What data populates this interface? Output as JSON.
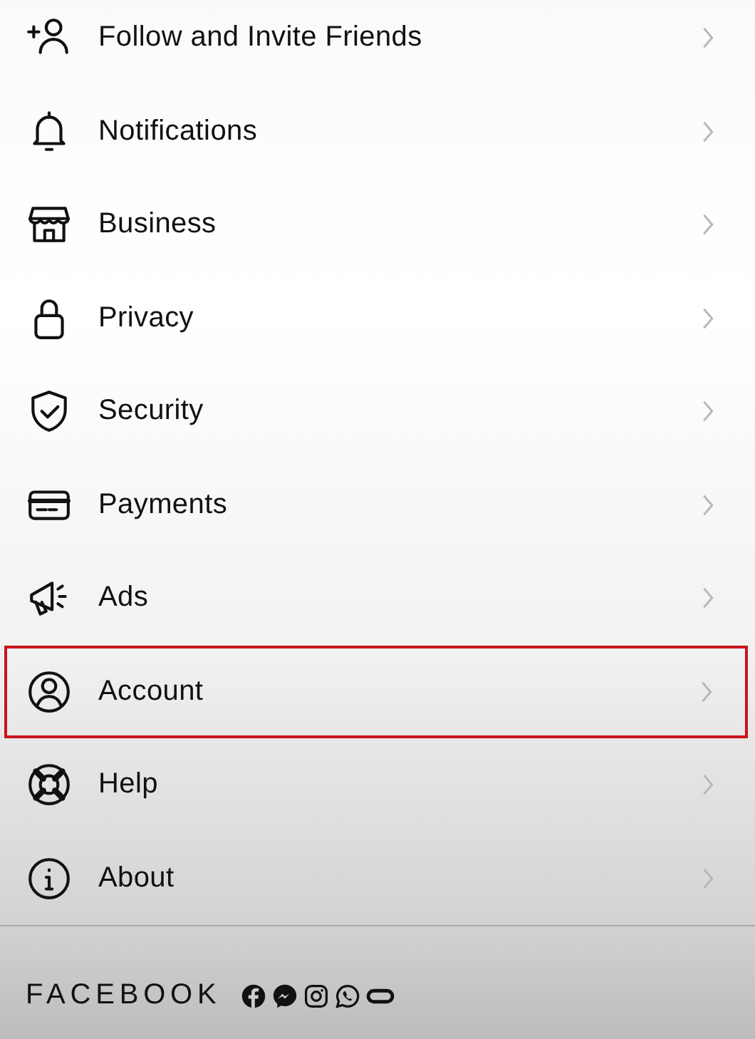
{
  "menu": [
    {
      "label": "Follow and Invite Friends",
      "selected": false
    },
    {
      "label": "Notifications",
      "selected": false
    },
    {
      "label": "Business",
      "selected": false
    },
    {
      "label": "Privacy",
      "selected": false
    },
    {
      "label": "Security",
      "selected": false
    },
    {
      "label": "Payments",
      "selected": false
    },
    {
      "label": "Ads",
      "selected": false
    },
    {
      "label": "Account",
      "selected": true
    },
    {
      "label": "Help",
      "selected": false
    },
    {
      "label": "About",
      "selected": false
    }
  ],
  "footer": {
    "brand": "FACEBOOK"
  }
}
